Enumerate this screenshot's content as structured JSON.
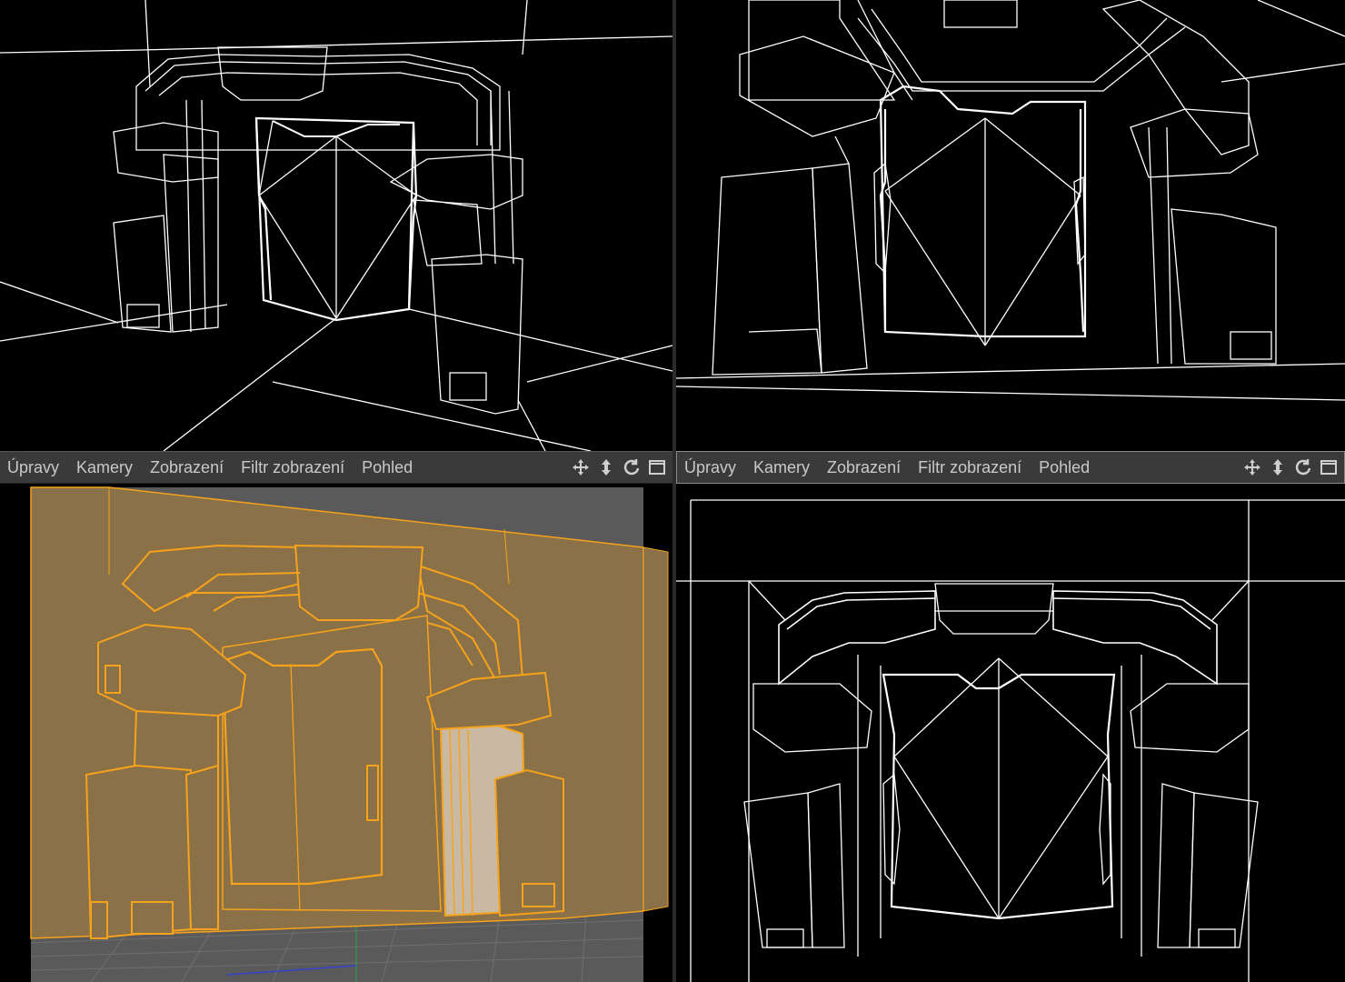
{
  "viewports": {
    "top_left": {
      "name": "perspective-view"
    },
    "top_right": {
      "name": "perspective-view-2"
    },
    "bottom_left": {
      "name": "shaded-view"
    },
    "bottom_right": {
      "name": "front-view"
    }
  },
  "menubar_left": {
    "items": [
      "Úpravy",
      "Kamery",
      "Zobrazení",
      "Filtr zobrazení",
      "Pohled"
    ],
    "icons": [
      "move-icon",
      "vertical-move-icon",
      "rotate-icon",
      "maximize-icon"
    ]
  },
  "menubar_right": {
    "items": [
      "Úpravy",
      "Kamery",
      "Zobrazení",
      "Filtr zobrazení",
      "Pohled"
    ],
    "icons": [
      "move-icon",
      "vertical-move-icon",
      "rotate-icon",
      "maximize-icon"
    ]
  },
  "colors": {
    "viewport_bg": "#000000",
    "wire": "#ffffff",
    "selection_orange": "#f7a21b",
    "shaded_fill": "#8a7148",
    "menubar_bg": "#3a3a3a",
    "menu_text": "#c9c9c9"
  }
}
